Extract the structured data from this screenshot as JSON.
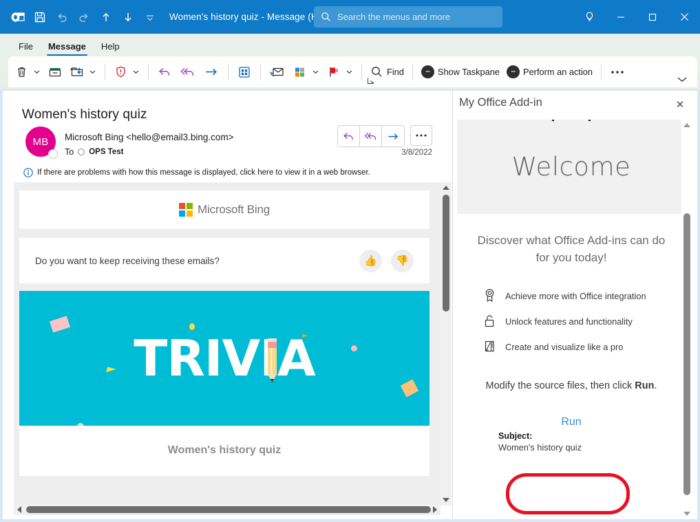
{
  "window": {
    "title": "Women's history quiz  -  Message (HT...",
    "quick_access": [
      {
        "name": "outlook-app-icon",
        "label": "Outlook"
      },
      {
        "name": "save-icon",
        "label": "Save"
      },
      {
        "name": "undo-icon",
        "label": "Undo"
      },
      {
        "name": "redo-icon",
        "label": "Redo"
      },
      {
        "name": "previous-item-icon",
        "label": "Previous Item"
      },
      {
        "name": "next-item-icon",
        "label": "Next Item"
      },
      {
        "name": "customize-quick-access-icon",
        "label": "Customize Quick Access Toolbar"
      }
    ],
    "search_placeholder": "Search the menus and more",
    "controls": {
      "help_tip": "Tell me what you want to do",
      "minimize": "Minimize",
      "maximize": "Maximize",
      "close": "Close"
    },
    "colors": {
      "titlebar": "#0f7ac7",
      "search_field": "#3e98d4",
      "accent": "#0f6cbd",
      "annotation": "#e81123"
    }
  },
  "ribbon": {
    "tabs": [
      {
        "label": "File",
        "active": false
      },
      {
        "label": "Message",
        "active": true
      },
      {
        "label": "Help",
        "active": false
      }
    ],
    "commands": [
      {
        "name": "delete-button",
        "label": "Delete",
        "icon": "trash-icon",
        "caret": true
      },
      {
        "name": "archive-button",
        "label": "Archive",
        "icon": "archive-icon",
        "caret": false
      },
      {
        "name": "move-button",
        "label": "Move",
        "icon": "move-to-folder-icon",
        "caret": true
      },
      {
        "name": "junk-button",
        "label": "Junk",
        "icon": "shield-alert-icon",
        "caret": true
      },
      {
        "name": "reply-button",
        "label": "Reply",
        "icon": "reply-icon",
        "caret": false
      },
      {
        "name": "reply-all-button",
        "label": "Reply All",
        "icon": "reply-all-icon",
        "caret": false
      },
      {
        "name": "forward-button",
        "label": "Forward",
        "icon": "forward-arrow-icon",
        "caret": false
      },
      {
        "name": "quick-steps-button",
        "label": "Quick Steps",
        "icon": "quick-steps-grid-icon",
        "caret": false
      },
      {
        "name": "read-unread-button",
        "label": "Mark Unread",
        "icon": "mark-unread-envelope-icon",
        "caret": false
      },
      {
        "name": "categorize-button",
        "label": "Categorize",
        "icon": "categorize-squares-icon",
        "caret": true
      },
      {
        "name": "follow-up-button",
        "label": "Follow Up",
        "icon": "flag-icon",
        "caret": true
      }
    ],
    "find_label": "Find",
    "show_taskpane_label": "Show Taskpane",
    "perform_action_label": "Perform an action",
    "overflow_label": "More options",
    "collapse_label": "Collapse the Ribbon",
    "dialog_launcher_label": "Tags dialog launcher"
  },
  "message": {
    "subject": "Women's history quiz",
    "avatar_initials": "MB",
    "sender": "Microsoft Bing <hello@email3.bing.com>",
    "to_label": "To",
    "to_recipient": "OPS Test",
    "date": "3/8/2022",
    "info_bar": "If there are problems with how this message is displayed, click here to view it in a web browser.",
    "actions": [
      {
        "name": "reply-button",
        "label": "Reply"
      },
      {
        "name": "reply-all-button",
        "label": "Reply All"
      },
      {
        "name": "forward-button",
        "label": "Forward"
      },
      {
        "name": "more-actions-button",
        "label": "More actions"
      }
    ],
    "body": {
      "brand": "Microsoft Bing",
      "feedback_question": "Do you want to keep receiving these emails?",
      "thumbs_up": "Thumbs up",
      "thumbs_down": "Thumbs down",
      "banner_word": "TRIVIA",
      "banner_color": "#00bcd4",
      "headline": "Women's history quiz"
    }
  },
  "taskpane": {
    "title": "My Office Add-in",
    "close_label": "Close",
    "hero_text": "Welcome",
    "tagline": "Discover what Office Add-ins can do for you today!",
    "features": [
      {
        "icon": "ribbon-award-icon",
        "label": "Achieve more with Office integration"
      },
      {
        "icon": "unlock-padlock-icon",
        "label": "Unlock features and functionality"
      },
      {
        "icon": "chart-pencil-icon",
        "label": "Create and visualize like a pro"
      }
    ],
    "modify_prefix": "Modify the source files, then click ",
    "modify_bold": "Run",
    "modify_suffix": ".",
    "run_label": "Run",
    "subject_label": "Subject:",
    "subject_value": "Women's history quiz"
  }
}
